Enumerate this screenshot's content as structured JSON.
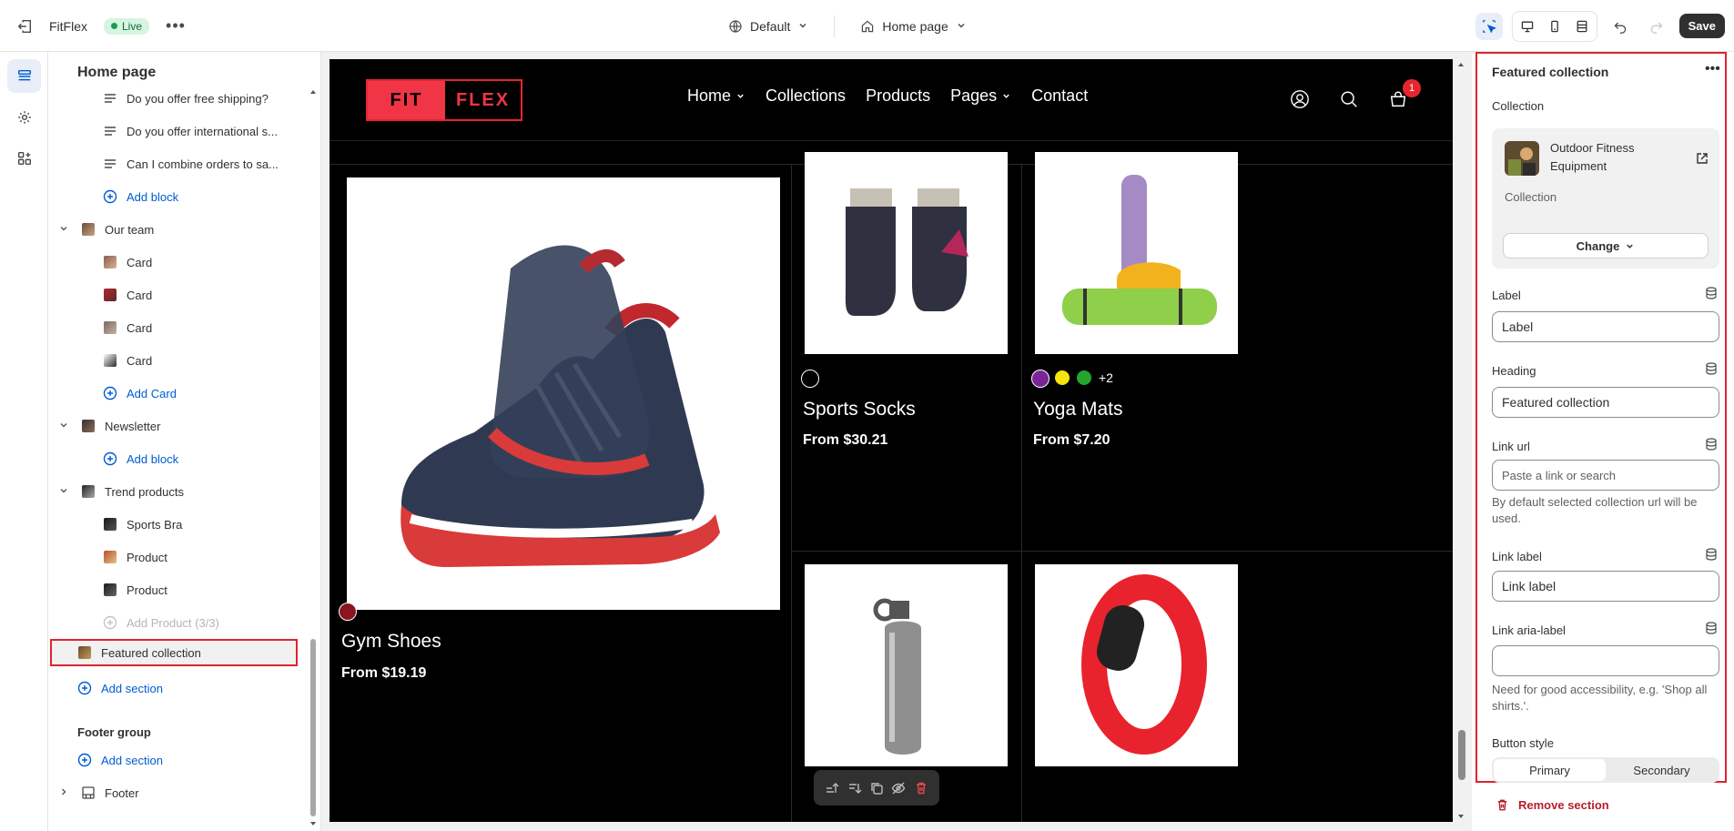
{
  "topbar": {
    "store_name": "FitFlex",
    "status": "Live",
    "theme": "Default",
    "page": "Home page",
    "save_label": "Save"
  },
  "sidebar": {
    "title": "Home page",
    "items": [
      {
        "label": "Do you offer free shipping?",
        "kind": "text-block"
      },
      {
        "label": "Do you offer international s...",
        "kind": "text-block"
      },
      {
        "label": "Can I combine orders to sa...",
        "kind": "text-block"
      },
      {
        "label": "Add block",
        "kind": "add"
      },
      {
        "label": "Our team",
        "kind": "section"
      },
      {
        "label": "Card",
        "kind": "card"
      },
      {
        "label": "Card",
        "kind": "card"
      },
      {
        "label": "Card",
        "kind": "card"
      },
      {
        "label": "Card",
        "kind": "card"
      },
      {
        "label": "Add Card",
        "kind": "add"
      },
      {
        "label": "Newsletter",
        "kind": "section"
      },
      {
        "label": "Add block",
        "kind": "add"
      },
      {
        "label": "Trend products",
        "kind": "section"
      },
      {
        "label": "Sports Bra",
        "kind": "product"
      },
      {
        "label": "Product",
        "kind": "product"
      },
      {
        "label": "Product",
        "kind": "product"
      },
      {
        "label": "Add Product (3/3)",
        "kind": "add-disabled"
      },
      {
        "label": "Featured collection",
        "kind": "selected"
      },
      {
        "label": "Add section",
        "kind": "add"
      }
    ],
    "footer_group_label": "Footer group",
    "footer_add": "Add section",
    "footer_item": "Footer"
  },
  "store": {
    "logo_left": "FIT",
    "logo_right": "FLEX",
    "nav": [
      "Home",
      "Collections",
      "Products",
      "Pages",
      "Contact"
    ],
    "cart_count": "1",
    "products": [
      {
        "name": "Gym Shoes",
        "price": "From $19.19"
      },
      {
        "name": "Sports Socks",
        "price": "From $30.21"
      },
      {
        "name": "Yoga Mats",
        "price": "From $7.20",
        "more_colors": "+2"
      }
    ]
  },
  "panel": {
    "title": "Featured collection",
    "collection_label": "Collection",
    "collection_name": "Outdoor Fitness Equipment",
    "collection_type": "Collection",
    "change_label": "Change",
    "label_label": "Label",
    "label_value": "Label",
    "heading_label": "Heading",
    "heading_value": "Featured collection",
    "link_url_label": "Link url",
    "link_url_placeholder": "Paste a link or search",
    "link_url_help": "By default selected collection url will be used.",
    "link_label_label": "Link label",
    "link_label_value": "Link label",
    "aria_label": "Link aria-label",
    "aria_help": "Need for good accessibility, e.g. 'Shop all shirts.'.",
    "button_style_label": "Button style",
    "style_primary": "Primary",
    "style_secondary": "Secondary",
    "remove_label": "Remove section"
  },
  "colors": {
    "accent": "#005bd3",
    "brand_red": "#f03546",
    "selection": "#e0232e"
  }
}
